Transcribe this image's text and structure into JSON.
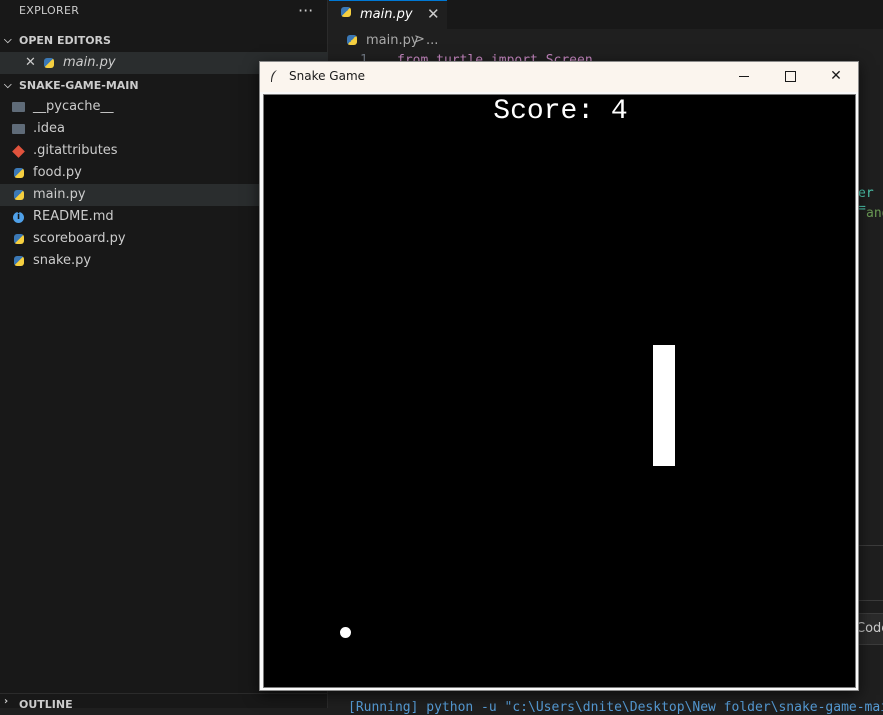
{
  "explorer": {
    "title": "EXPLORER",
    "more": "···",
    "open_editors": {
      "header": "OPEN EDITORS",
      "items": [
        {
          "label": "main.py"
        }
      ]
    },
    "project": {
      "header": "SNAKE-GAME-MAIN",
      "items": [
        {
          "label": "__pycache__",
          "icon": "folder-icon"
        },
        {
          "label": ".idea",
          "icon": "folder-icon"
        },
        {
          "label": ".gitattributes",
          "icon": "git-icon"
        },
        {
          "label": "food.py",
          "icon": "python-icon"
        },
        {
          "label": "main.py",
          "icon": "python-icon",
          "selected": true
        },
        {
          "label": "README.md",
          "icon": "info-icon"
        },
        {
          "label": "scoreboard.py",
          "icon": "python-icon"
        },
        {
          "label": "snake.py",
          "icon": "python-icon"
        }
      ]
    },
    "outline": "OUTLINE"
  },
  "editor": {
    "tab": {
      "label": "main.py",
      "close": "✕"
    },
    "breadcrumb": {
      "file": "main.py",
      "sep": ">",
      "more": "..."
    },
    "code_fragments": {
      "line1_no": "1",
      "line1": "from turtle import Screen",
      "frag_a": "er =",
      "frag_b": "and"
    },
    "code_button": "Code",
    "terminal": "[Running] python -u \"c:\\Users\\dnite\\Desktop\\New folder\\snake-game-main"
  },
  "game_window": {
    "title": "Snake Game",
    "minimize": "—",
    "maximize": "□",
    "close": "✕",
    "score_label": "Score: 4",
    "score_value": 4
  },
  "colors": {
    "accent": "#0078d4",
    "canvas_bg": "#000000",
    "snake": "#ffffff",
    "food": "#ffffff"
  }
}
